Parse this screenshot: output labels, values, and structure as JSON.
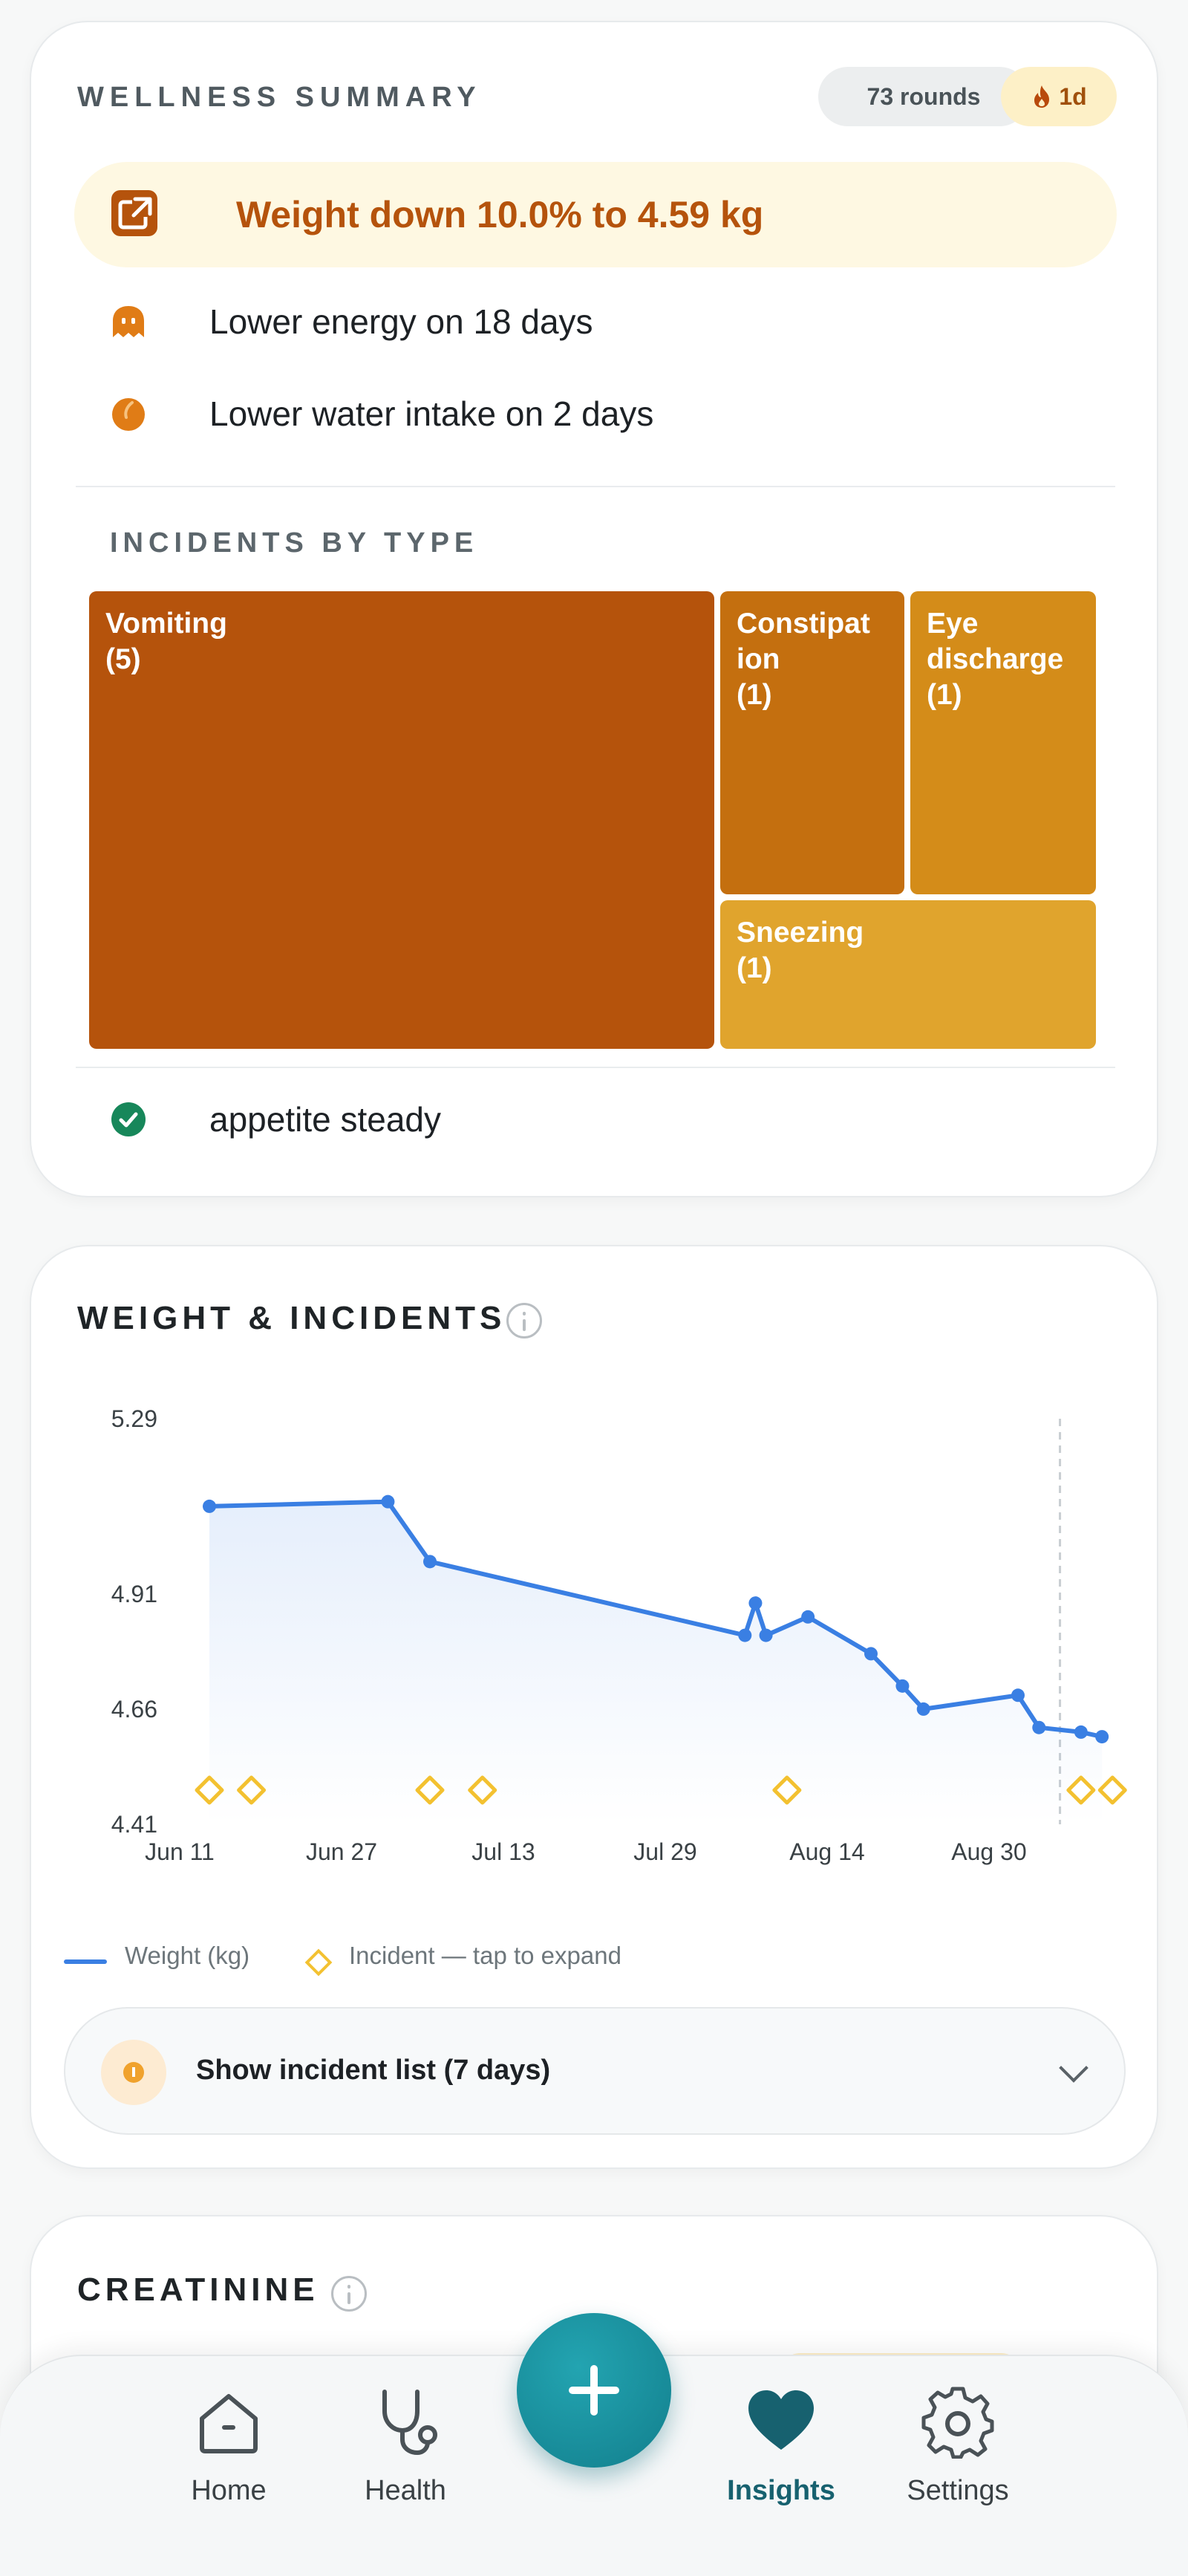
{
  "summary": {
    "title": "WELLNESS SUMMARY",
    "rounds_badge": "73 rounds",
    "streak_badge": "1d",
    "highlight": "Weight down 10.0% to 4.59 kg",
    "notes": [
      {
        "icon": "ghost-icon",
        "text": "Lower energy on 18 days"
      },
      {
        "icon": "water-drop-icon",
        "text": "Lower water intake on 2 days"
      }
    ],
    "incidents_title": "INCIDENTS BY TYPE",
    "incidents": [
      {
        "label": "Vomiting",
        "count_label": "(5)",
        "count": 5,
        "color": "#b5530c"
      },
      {
        "label": "Constipat ion",
        "count_label": "(1)",
        "count": 1,
        "color": "#c46f0f"
      },
      {
        "label": "Eye discharge",
        "count_label": "(1)",
        "count": 1,
        "color": "#d48c19"
      },
      {
        "label": "Sneezing",
        "count_label": "(1)",
        "count": 1,
        "color": "#e0a42d"
      }
    ],
    "status_icon": "check-circle-icon",
    "status_text": "appetite steady"
  },
  "weight_chart": {
    "title": "WEIGHT & INCIDENTS",
    "legend": {
      "weight": "Weight (kg)",
      "incident": "Incident — tap to expand"
    },
    "toggle_label": "Show incident list (7 days)"
  },
  "chart_data": {
    "type": "line",
    "title": "WEIGHT & INCIDENTS",
    "xlabel": "",
    "ylabel": "",
    "yticks": [
      "5.29",
      "4.91",
      "4.66",
      "4.41"
    ],
    "ylim": [
      4.41,
      5.29
    ],
    "xticks": [
      "Jun 11",
      "Jun 27",
      "Jul 13",
      "Jul 29",
      "Aug 14",
      "Aug 30"
    ],
    "xlim": [
      "2024-06-11",
      "2024-09-03"
    ],
    "grid": false,
    "series": [
      {
        "name": "Weight (kg)",
        "color": "#3a7fe3",
        "points": [
          {
            "x": "2024-06-11",
            "y": 5.1
          },
          {
            "x": "2024-06-28",
            "y": 5.11
          },
          {
            "x": "2024-07-02",
            "y": 4.98
          },
          {
            "x": "2024-08-01",
            "y": 4.82
          },
          {
            "x": "2024-08-02",
            "y": 4.89
          },
          {
            "x": "2024-08-03",
            "y": 4.82
          },
          {
            "x": "2024-08-07",
            "y": 4.86
          },
          {
            "x": "2024-08-13",
            "y": 4.78
          },
          {
            "x": "2024-08-16",
            "y": 4.71
          },
          {
            "x": "2024-08-18",
            "y": 4.66
          },
          {
            "x": "2024-08-27",
            "y": 4.69
          },
          {
            "x": "2024-08-29",
            "y": 4.62
          },
          {
            "x": "2024-09-02",
            "y": 4.61
          },
          {
            "x": "2024-09-04",
            "y": 4.6
          }
        ]
      }
    ],
    "incidents": [
      "2024-06-11",
      "2024-06-15",
      "2024-07-02",
      "2024-07-07",
      "2024-08-05",
      "2024-09-02",
      "2024-09-05"
    ],
    "today_marker": "2024-08-31"
  },
  "creatinine": {
    "title": "CREATININE"
  },
  "nav": {
    "home": "Home",
    "health": "Health",
    "insights": "Insights",
    "settings": "Settings"
  }
}
